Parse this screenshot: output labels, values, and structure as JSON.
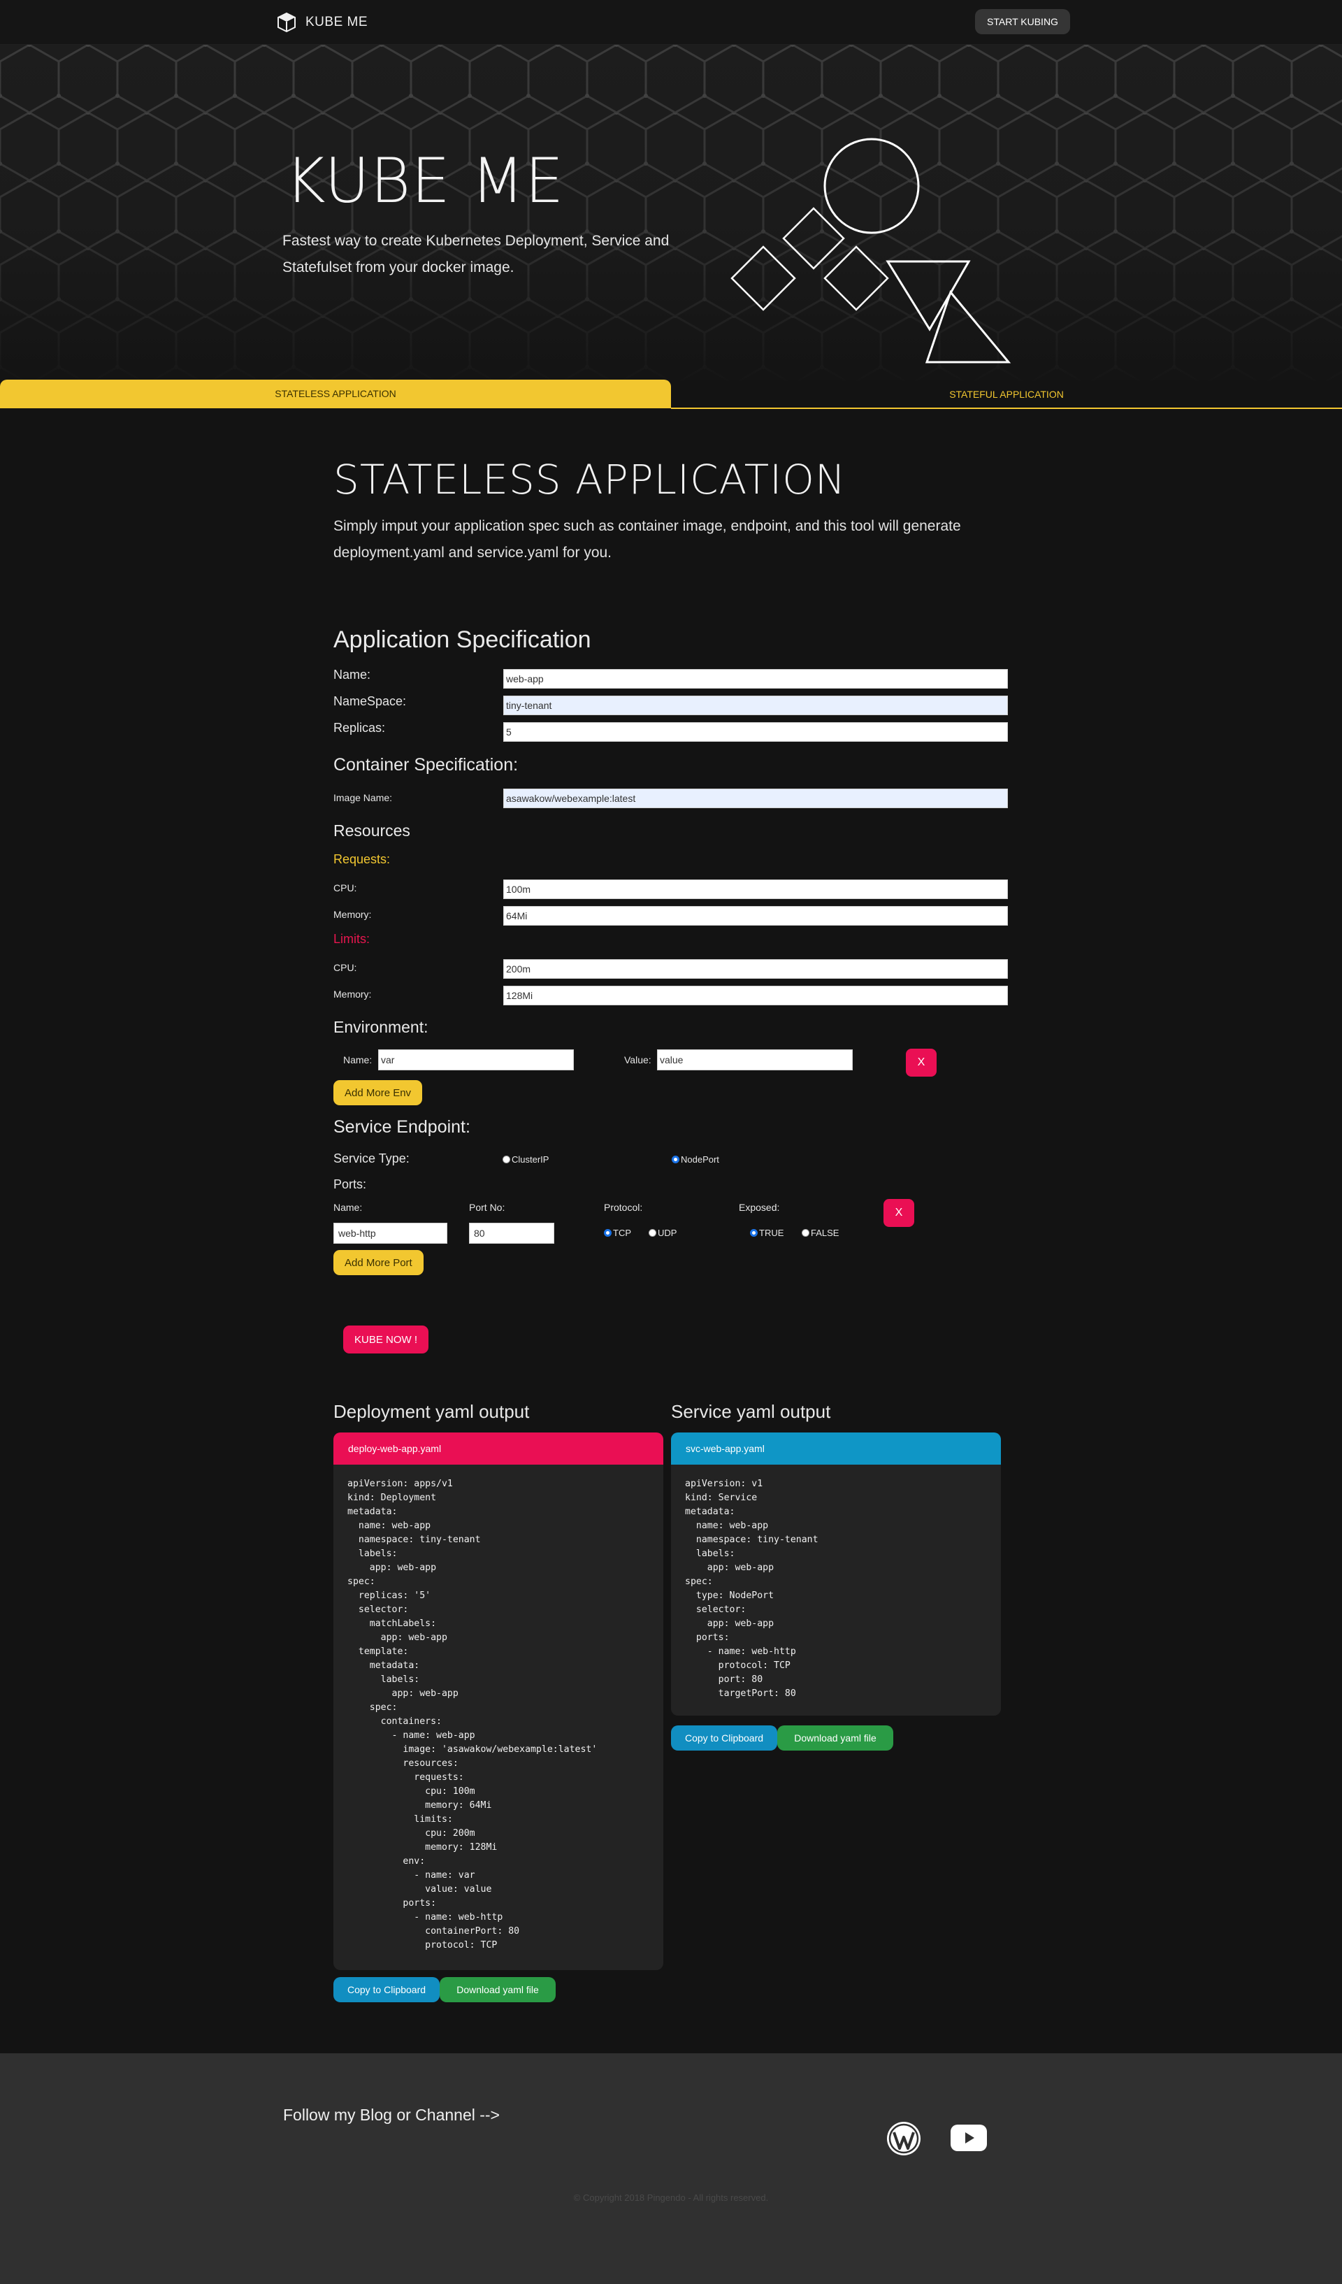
{
  "nav": {
    "brand": "KUBE ME",
    "cta": "START KUBING"
  },
  "hero": {
    "title": "KUBE ME",
    "subtitle": "Fastest way to create Kubernetes Deployment, Service and Statefulset from your docker image."
  },
  "tabs": {
    "stateless": "STATELESS APPLICATION",
    "stateful": "STATEFUL APPLICATION"
  },
  "section": {
    "title": "STATELESS APPLICATION",
    "description": "Simply imput your application spec such as container image, endpoint, and this tool will generate deployment.yaml and service.yaml for you."
  },
  "app_spec": {
    "heading": "Application Specification",
    "name_label": "Name:",
    "name_value": "web-app",
    "namespace_label": "NameSpace:",
    "namespace_value": "tiny-tenant",
    "replicas_label": "Replicas:",
    "replicas_value": "5"
  },
  "container_spec": {
    "heading": "Container Specification:",
    "image_label": "Image Name:",
    "image_value": "asawakow/webexample:latest"
  },
  "resources": {
    "heading": "Resources",
    "requests_label": "Requests:",
    "req_cpu_label": "CPU:",
    "req_cpu_value": "100m",
    "req_mem_label": "Memory:",
    "req_mem_value": "64Mi",
    "limits_label": "Limits:",
    "lim_cpu_label": "CPU:",
    "lim_cpu_value": "200m",
    "lim_mem_label": "Memory:",
    "lim_mem_value": "128Mi"
  },
  "environment": {
    "heading": "Environment:",
    "name_label": "Name:",
    "name_value": "var",
    "value_label": "Value:",
    "value_value": "value",
    "remove_label": "X",
    "add_label": "Add More Env"
  },
  "service": {
    "heading": "Service Endpoint:",
    "type_label": "Service Type:",
    "type_options": [
      "ClusterIP",
      "NodePort"
    ],
    "type_selected": "NodePort",
    "ports_label": "Ports:",
    "col_name": "Name:",
    "col_port": "Port No:",
    "col_protocol": "Protocol:",
    "col_exposed": "Exposed:",
    "port_name_value": "web-http",
    "port_no_value": "80",
    "protocol_options": [
      "TCP",
      "UDP"
    ],
    "protocol_selected": "TCP",
    "exposed_options": [
      "TRUE",
      "FALSE"
    ],
    "exposed_selected": "TRUE",
    "remove_label": "X",
    "add_label": "Add More Port"
  },
  "kube_button": "KUBE NOW !",
  "deployment_output": {
    "title": "Deployment yaml output",
    "filename": "deploy-web-app.yaml",
    "header_color": "#ea0f54",
    "yaml": "apiVersion: apps/v1\nkind: Deployment\nmetadata:\n  name: web-app\n  namespace: tiny-tenant\n  labels:\n    app: web-app\nspec:\n  replicas: '5'\n  selector:\n    matchLabels:\n      app: web-app\n  template:\n    metadata:\n      labels:\n        app: web-app\n    spec:\n      containers:\n        - name: web-app\n          image: 'asawakow/webexample:latest'\n          resources:\n            requests:\n              cpu: 100m\n              memory: 64Mi\n            limits:\n              cpu: 200m\n              memory: 128Mi\n          env:\n            - name: var\n              value: value\n          ports:\n            - name: web-http\n              containerPort: 80\n              protocol: TCP",
    "copy_label": "Copy to Clipboard",
    "download_label": "Download yaml file"
  },
  "service_output": {
    "title": "Service yaml output",
    "filename": "svc-web-app.yaml",
    "header_color": "#0f96c6",
    "yaml": "apiVersion: v1\nkind: Service\nmetadata:\n  name: web-app\n  namespace: tiny-tenant\n  labels:\n    app: web-app\nspec:\n  type: NodePort\n  selector:\n    app: web-app\n  ports:\n    - name: web-http\n      protocol: TCP\n      port: 80\n      targetPort: 80",
    "copy_label": "Copy to Clipboard",
    "download_label": "Download yaml file"
  },
  "footer": {
    "follow_text": "Follow my Blog or Channel  -->",
    "icons": [
      "wordpress-icon",
      "youtube-icon"
    ],
    "copyright": "© Copyright 2018 Pingendo - All rights reserved."
  },
  "colors": {
    "accent_yellow": "#f2c730",
    "accent_pink": "#ea0f54",
    "accent_blue": "#118ec1",
    "accent_green": "#2a9b45"
  }
}
